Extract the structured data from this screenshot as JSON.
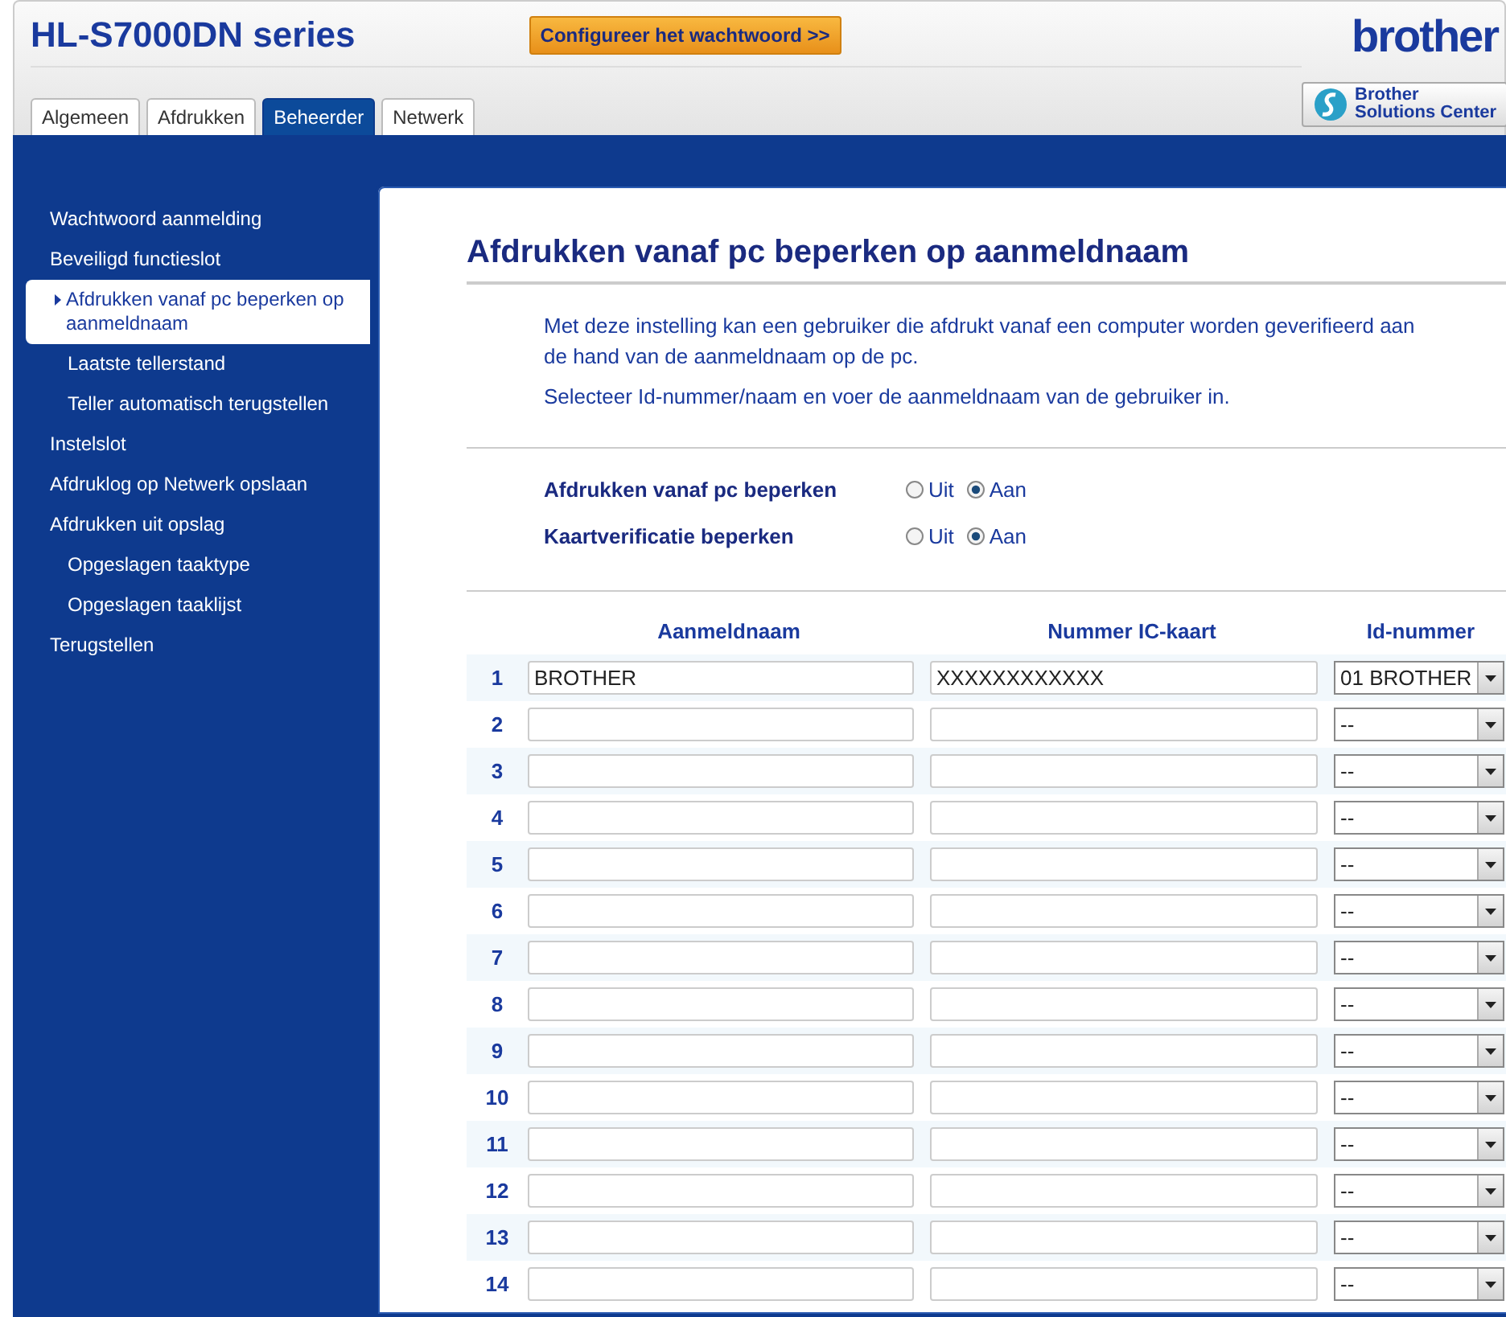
{
  "header": {
    "title": "HL-S7000DN series",
    "password_button": "Configureer het wachtwoord >>",
    "logo": "brother",
    "solutions_center": {
      "line1": "Brother",
      "line2": "Solutions Center"
    }
  },
  "tabs": [
    {
      "label": "Algemeen",
      "selected": false
    },
    {
      "label": "Afdrukken",
      "selected": false
    },
    {
      "label": "Beheerder",
      "selected": true
    },
    {
      "label": "Netwerk",
      "selected": false
    }
  ],
  "sidebar": {
    "items": [
      {
        "label": "Wachtwoord aanmelding",
        "selected": false
      },
      {
        "label": "Beveiligd functieslot",
        "selected": false,
        "children": [
          {
            "label": "Afdrukken vanaf pc beperken op aanmeldnaam",
            "selected": true
          },
          {
            "label": "Laatste tellerstand",
            "selected": false
          },
          {
            "label": "Teller automatisch terugstellen",
            "selected": false
          }
        ]
      },
      {
        "label": "Instelslot",
        "selected": false
      },
      {
        "label": "Afdruklog op Netwerk opslaan",
        "selected": false
      },
      {
        "label": "Afdrukken uit opslag",
        "selected": false,
        "children": [
          {
            "label": "Opgeslagen taaktype",
            "selected": false
          },
          {
            "label": "Opgeslagen taaklijst",
            "selected": false
          }
        ]
      },
      {
        "label": "Terugstellen",
        "selected": false
      }
    ]
  },
  "content": {
    "title": "Afdrukken vanaf pc beperken op aanmeldnaam",
    "paragraphs": [
      "Met deze instelling kan een gebruiker die afdrukt vanaf een computer worden geverifieerd aan de hand van de aanmeldnaam op de pc.",
      "Selecteer Id-nummer/naam en voer de aanmeldnaam van de gebruiker in."
    ],
    "settings": [
      {
        "label": "Afdrukken vanaf pc beperken",
        "options": [
          {
            "label": "Uit",
            "selected": false
          },
          {
            "label": "Aan",
            "selected": true
          }
        ]
      },
      {
        "label": "Kaartverificatie beperken",
        "options": [
          {
            "label": "Uit",
            "selected": false
          },
          {
            "label": "Aan",
            "selected": true
          }
        ]
      }
    ],
    "table": {
      "columns": [
        "Aanmeldnaam",
        "Nummer IC-kaart",
        "Id-nummer"
      ],
      "rows": [
        {
          "number": "1",
          "name": "BROTHER",
          "card": "XXXXXXXXXXXX",
          "id": "01 BROTHER"
        },
        {
          "number": "2",
          "id": "--"
        },
        {
          "number": "3",
          "id": "--"
        },
        {
          "number": "4",
          "id": "--"
        },
        {
          "number": "5",
          "id": "--"
        },
        {
          "number": "6",
          "id": "--"
        },
        {
          "number": "7",
          "id": "--"
        },
        {
          "number": "8",
          "id": "--"
        },
        {
          "number": "9",
          "id": "--"
        },
        {
          "number": "10",
          "id": "--"
        },
        {
          "number": "11",
          "id": "--"
        },
        {
          "number": "12",
          "id": "--"
        },
        {
          "number": "13",
          "id": "--"
        },
        {
          "number": "14",
          "id": "--"
        }
      ]
    }
  }
}
